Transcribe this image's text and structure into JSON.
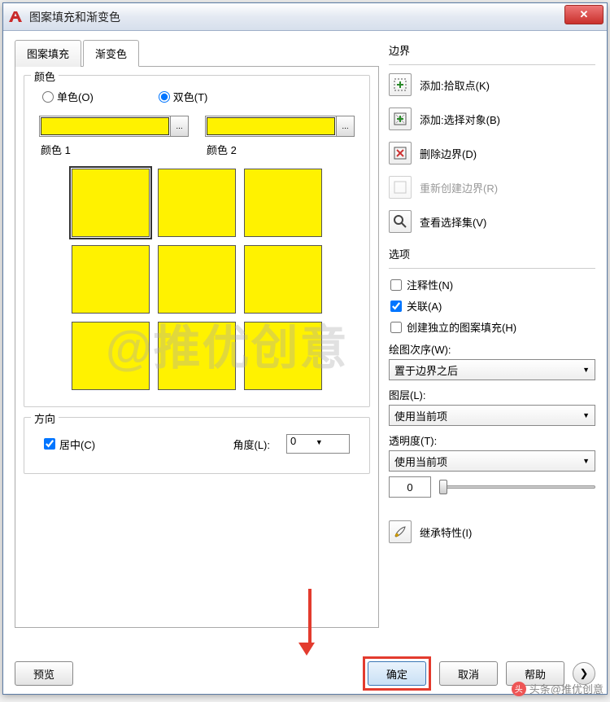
{
  "window": {
    "title": "图案填充和渐变色"
  },
  "tabs": {
    "hatch": "图案填充",
    "gradient": "渐变色"
  },
  "color_group": {
    "title": "颜色",
    "one_color": "单色(O)",
    "two_color": "双色(T)",
    "two_color_checked": true,
    "label1": "颜色 1",
    "label2": "颜色 2",
    "swatch_btn": "..."
  },
  "direction": {
    "title": "方向",
    "center": "居中(C)",
    "center_checked": true,
    "angle_label": "角度(L):",
    "angle_value": "0"
  },
  "boundary": {
    "title": "边界",
    "add_pick": "添加:拾取点(K)",
    "add_select": "添加:选择对象(B)",
    "remove": "删除边界(D)",
    "recreate": "重新创建边界(R)",
    "view": "查看选择集(V)"
  },
  "options": {
    "title": "选项",
    "annotative": "注释性(N)",
    "associative": "关联(A)",
    "associative_checked": true,
    "separate": "创建独立的图案填充(H)",
    "draw_order_label": "绘图次序(W):",
    "draw_order_value": "置于边界之后",
    "layer_label": "图层(L):",
    "layer_value": "使用当前项",
    "transparency_label": "透明度(T):",
    "transparency_value": "使用当前项",
    "transparency_num": "0"
  },
  "inherit": "继承特性(I)",
  "buttons": {
    "preview": "预览",
    "ok": "确定",
    "cancel": "取消",
    "help": "帮助"
  },
  "watermark": "@推优创意",
  "footer": "头条@推优创意"
}
